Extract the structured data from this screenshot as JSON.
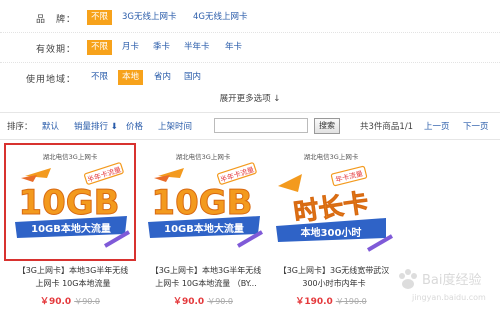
{
  "filters": [
    {
      "label": "品　牌：",
      "options": [
        {
          "text": "不限",
          "selected": true
        },
        {
          "text": "3G无线上网卡",
          "selected": false
        },
        {
          "text": "4G无线上网卡",
          "selected": false
        }
      ]
    },
    {
      "label": "有效期：",
      "options": [
        {
          "text": "不限",
          "selected": true
        },
        {
          "text": "月卡",
          "selected": false
        },
        {
          "text": "季卡",
          "selected": false
        },
        {
          "text": "半年卡",
          "selected": false
        },
        {
          "text": "年卡",
          "selected": false
        }
      ]
    },
    {
      "label": "使用地域：",
      "options": [
        {
          "text": "不限",
          "selected": false
        },
        {
          "text": "本地",
          "selected": true
        },
        {
          "text": "省内",
          "selected": false
        },
        {
          "text": "国内",
          "selected": false
        }
      ]
    }
  ],
  "more_options": "展开更多选项",
  "sort": {
    "label": "排序：",
    "items": [
      "默认",
      "销量排行",
      "价格",
      "上架时间"
    ],
    "search_button": "搜索",
    "summary": "共3件商品1/1",
    "prev": "上一页",
    "next": "下一页"
  },
  "products": [
    {
      "banner": "湖北电信3G上网卡",
      "tag": "半年卡流量",
      "big": "10GB",
      "sub": "10GB本地大流量",
      "title_line1": "【3G上网卡】本地3G半年无线",
      "title_line2": "上网卡 10G本地流量",
      "price": "￥90.0",
      "orig_price": "￥90.0",
      "selected": true
    },
    {
      "banner": "湖北电信3G上网卡",
      "tag": "半年卡流量",
      "big": "10GB",
      "sub": "10GB本地大流量",
      "title_line1": "【3G上网卡】本地3G半年无线",
      "title_line2": "上网卡 10G本地流量 （BY...",
      "price": "￥90.0",
      "orig_price": "￥90.0",
      "selected": false
    },
    {
      "banner": "湖北电信3G上网卡",
      "tag": "年卡流量",
      "big": "时长卡",
      "sub": "本地300小时",
      "title_line1": "【3G上网卡】3G无线宽带武汉",
      "title_line2": "300小时市内年卡",
      "price": "￥190.0",
      "orig_price": "￥190.0",
      "selected": false
    }
  ],
  "watermark": "Bai度经验",
  "watermark_sub": "jingyan.baidu.com",
  "colors": {
    "accent": "#f7a21b",
    "link": "#2a5caa",
    "price": "#e4393c",
    "select_border": "#d8322f"
  }
}
